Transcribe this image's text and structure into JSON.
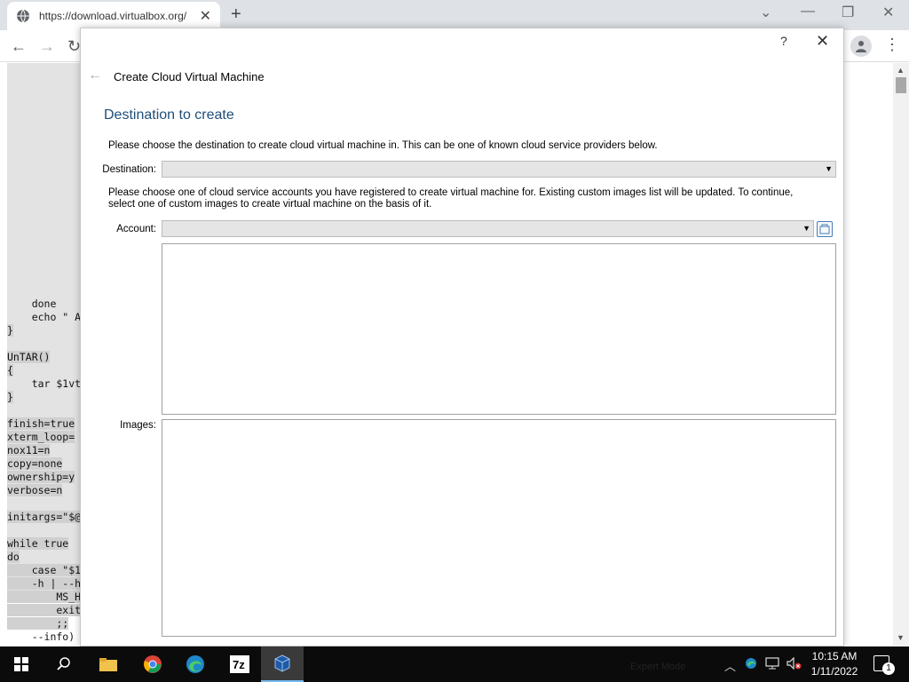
{
  "browser": {
    "tab_title": "https://download.virtualbox.org/",
    "tab_close": "✕",
    "new_tab": "+",
    "win_min": "—",
    "win_restore": "❐",
    "win_close": "✕",
    "win_dropdown": "⌄"
  },
  "page": {
    "code_lines": [
      {
        "text": "    done",
        "hl": false
      },
      {
        "text": "    echo \" A",
        "hl": false
      },
      {
        "text": "}",
        "hl": true
      },
      {
        "text": "",
        "hl": false
      },
      {
        "text": "UnTAR()",
        "hl": true
      },
      {
        "text": "{",
        "hl": true
      },
      {
        "text": "    tar $1vt",
        "hl": false
      },
      {
        "text": "}",
        "hl": true
      },
      {
        "text": "",
        "hl": false
      },
      {
        "text": "finish=true",
        "hl": true
      },
      {
        "text": "xterm_loop=",
        "hl": true
      },
      {
        "text": "nox11=n",
        "hl": true
      },
      {
        "text": "copy=none",
        "hl": true
      },
      {
        "text": "ownership=y",
        "hl": true
      },
      {
        "text": "verbose=n",
        "hl": true
      },
      {
        "text": "",
        "hl": true
      },
      {
        "text": "initargs=\"$@",
        "hl": true
      },
      {
        "text": "",
        "hl": false
      },
      {
        "text": "while true",
        "hl": true
      },
      {
        "text": "do",
        "hl": true
      },
      {
        "text": "    case \"$1",
        "hl": true
      },
      {
        "text": "    -h | --h",
        "hl": true
      },
      {
        "text": "        MS_H",
        "hl": true
      },
      {
        "text": "        exit",
        "hl": true
      },
      {
        "text": "        ;;",
        "hl": true
      },
      {
        "text": "    --info)",
        "hl": false
      }
    ]
  },
  "dialog": {
    "help": "?",
    "close": "✕",
    "title": "Create Cloud Virtual Machine",
    "heading": "Destination to create",
    "destination_desc": "Please choose the destination to create cloud virtual machine in. This can be one of known cloud service providers below.",
    "destination_label": "Destination:",
    "destination_value": "",
    "account_desc": "Please choose one of cloud service accounts you have registered to create virtual machine for. Existing custom images list will be updated. To continue, select one of custom images to create virtual machine on the basis of it.",
    "account_label": "Account:",
    "account_value": "",
    "images_label": "Images:"
  },
  "taskbar": {
    "expert_mode": "Expert Mode",
    "time": "10:15 AM",
    "date": "1/11/2022",
    "notif_count": "1"
  },
  "colors": {
    "heading": "#1f4e79",
    "taskbar": "#0b0b0b",
    "accent": "#76b9ed"
  }
}
